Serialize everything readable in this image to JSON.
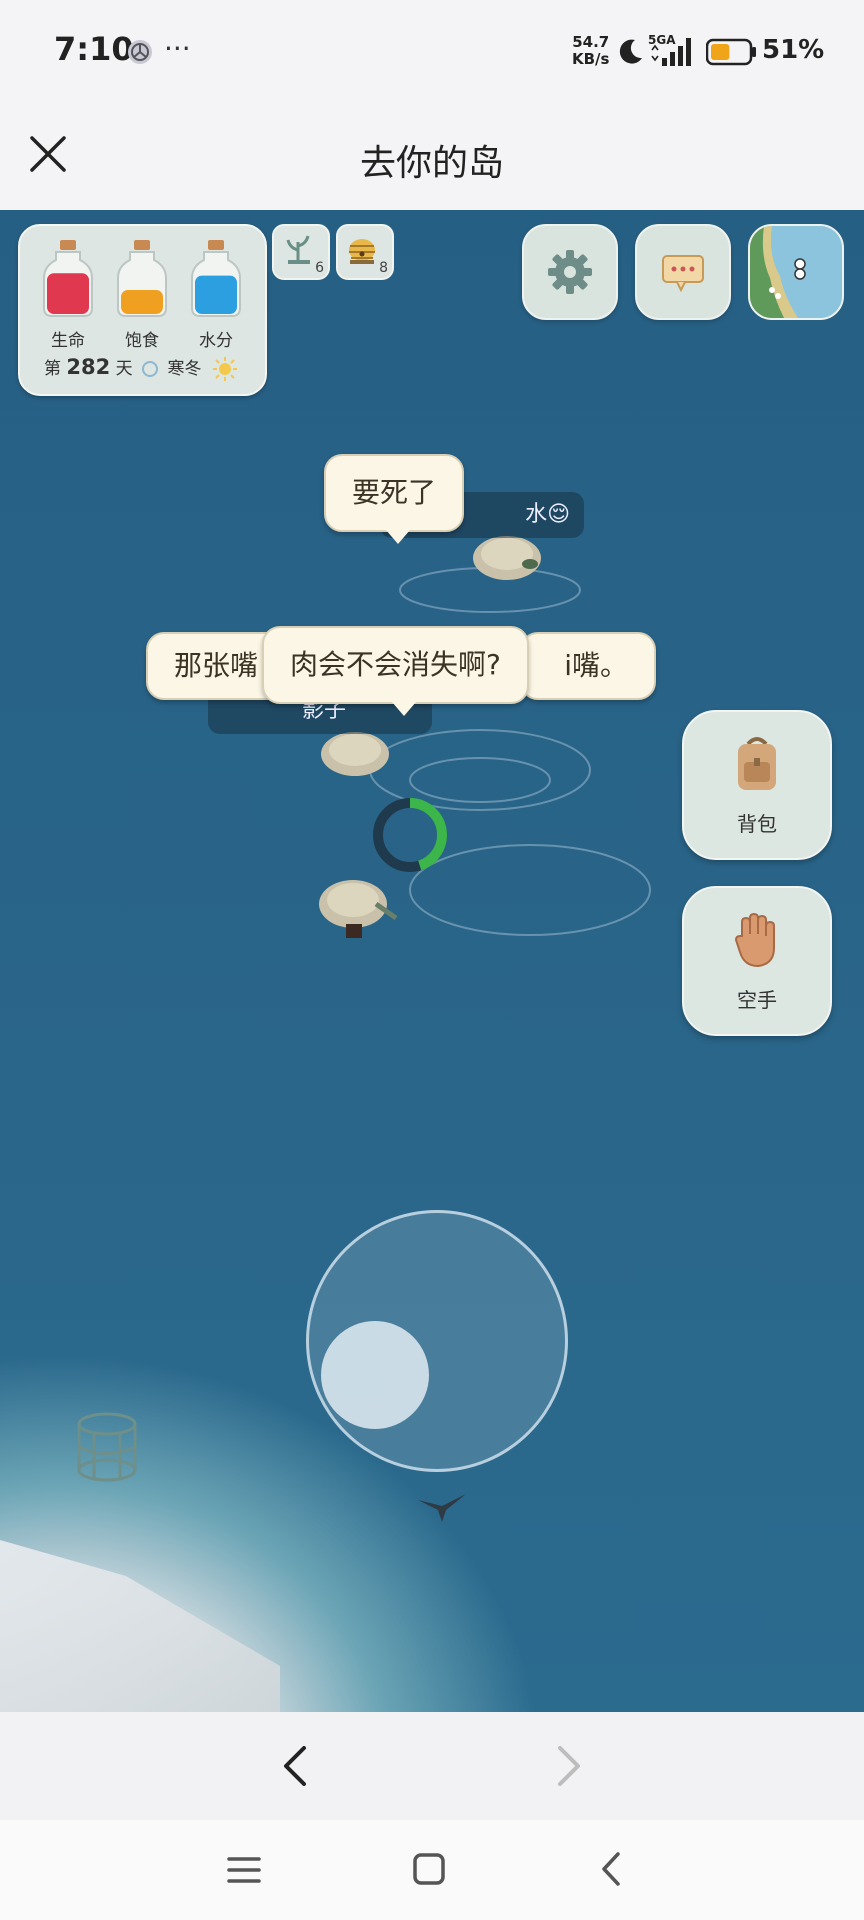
{
  "status_bar": {
    "time": "7:10",
    "net_speed_value": "54.7",
    "net_speed_unit": "KB/s",
    "network": "5GA",
    "battery": "51%",
    "battery_level": 0.51
  },
  "header": {
    "title": "去你的岛"
  },
  "stats": {
    "bottles": [
      {
        "label": "生命",
        "color": "#e0394f",
        "level": 0.85
      },
      {
        "label": "饱食",
        "color": "#f0a020",
        "level": 0.5
      },
      {
        "label": "水分",
        "color": "#2c9fe0",
        "level": 0.8
      }
    ],
    "day_prefix": "第",
    "day_number": "282",
    "day_suffix": "天",
    "season": "寒冬"
  },
  "mini_badges": [
    {
      "icon": "sprout-icon",
      "count": "6"
    },
    {
      "icon": "beehive-icon",
      "count": "8"
    }
  ],
  "speech": {
    "bubble_top": "要死了",
    "nametag_top_suffix": "水😌",
    "bubble_left_partial": "那张嘴",
    "bubble_center": "肉会不会消失啊?",
    "bubble_right_partial": "i嘴。",
    "nametag_middle": "影子"
  },
  "progress": {
    "value": 0.45,
    "color": "#3cb54a"
  },
  "side_buttons": {
    "backpack_label": "背包",
    "hand_label": "空手"
  },
  "colors": {
    "sea": "#265f84",
    "panel": "#dde6e2"
  }
}
